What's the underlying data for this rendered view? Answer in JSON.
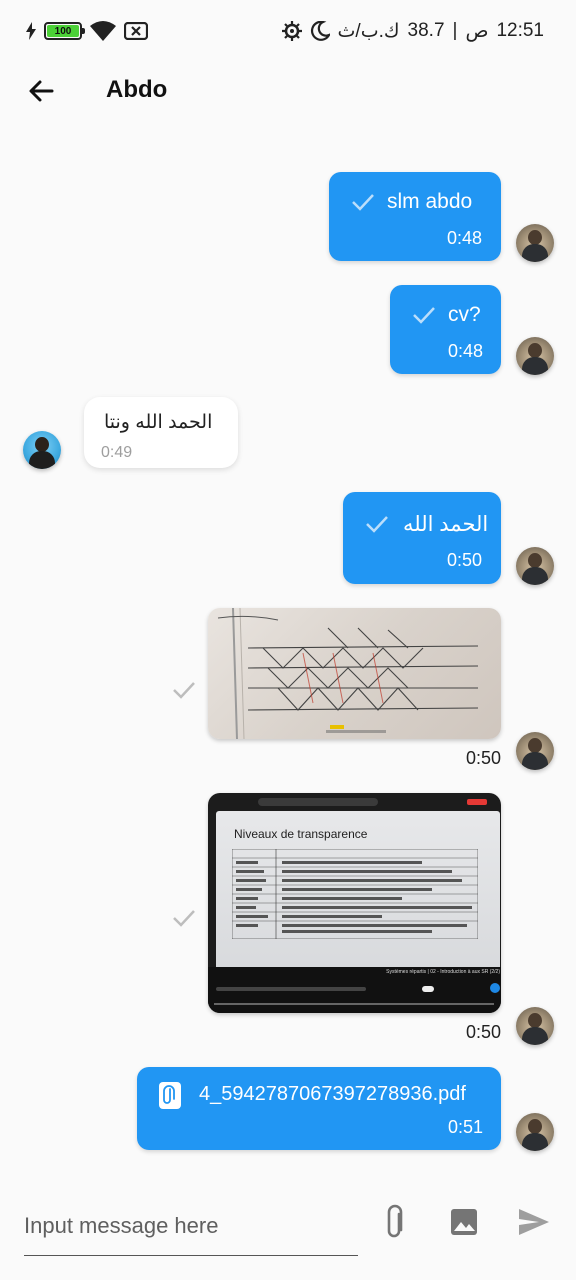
{
  "status_bar": {
    "time": "12:51",
    "am_pm": "ص",
    "separator": "|",
    "speed": "38.7",
    "speed_unit": "ك.ب/ث",
    "battery_level": "100",
    "icons": [
      "charging-icon",
      "battery-icon",
      "wifi-icon",
      "no-sim-icon",
      "moon-icon",
      "settings-icon"
    ]
  },
  "header": {
    "title": "Abdo",
    "back_icon": "arrow-left-icon"
  },
  "messages": [
    {
      "type": "text",
      "direction": "outgoing",
      "text": "slm abdo",
      "time": "0:48"
    },
    {
      "type": "text",
      "direction": "outgoing",
      "text": "cv?",
      "time": "0:48"
    },
    {
      "type": "text",
      "direction": "incoming",
      "text": "الحمد الله ونتا",
      "time": "0:49"
    },
    {
      "type": "text",
      "direction": "outgoing",
      "text": "الحمد الله",
      "time": "0:50"
    },
    {
      "type": "image",
      "direction": "outgoing",
      "description_icon": "whiteboard-photo",
      "time": "0:50"
    },
    {
      "type": "image",
      "direction": "outgoing",
      "description_icon": "slide-photo",
      "time": "0:50",
      "slide_title": "Niveaux de transparence",
      "slide_footer": "Systèmes répartis | 02 - Introduction à aux SR (2/2)"
    },
    {
      "type": "file",
      "direction": "outgoing",
      "filename": "4_5942787067397278936.pdf",
      "time": "0:51"
    }
  ],
  "input": {
    "placeholder": "Input message here",
    "value": ""
  },
  "colors": {
    "accent": "#2196f3",
    "background": "#fafafa",
    "incoming_bubble": "#ffffff"
  }
}
